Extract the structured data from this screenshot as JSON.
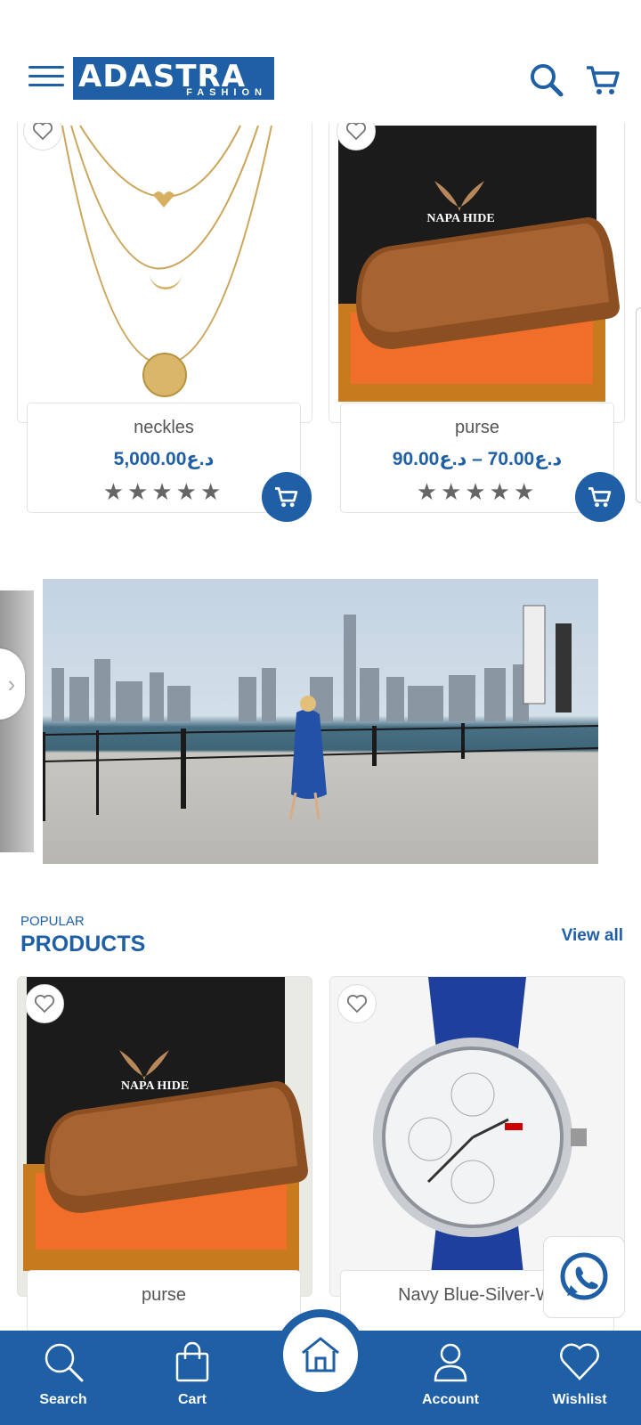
{
  "header": {
    "logo_main": "ADASTRA",
    "logo_sub": "FASHION"
  },
  "top_products": [
    {
      "name": "neckles",
      "price": "د.ع5,000.00",
      "stars": "★★★★★"
    },
    {
      "name": "purse",
      "price": "د.ع70.00 – د.ع90.00",
      "stars": "★★★★★"
    }
  ],
  "wallet_brand": "NAPA HIDE",
  "popular": {
    "subtitle": "POPULAR",
    "title": "PRODUCTS",
    "view_all": "View all",
    "items": [
      {
        "name": "purse"
      },
      {
        "name": "Navy Blue-Silver-Wl"
      }
    ]
  },
  "bottom_nav": {
    "search": "Search",
    "cart": "Cart",
    "account": "Account",
    "wishlist": "Wishlist"
  },
  "colors": {
    "brand": "#1f5fa6"
  }
}
